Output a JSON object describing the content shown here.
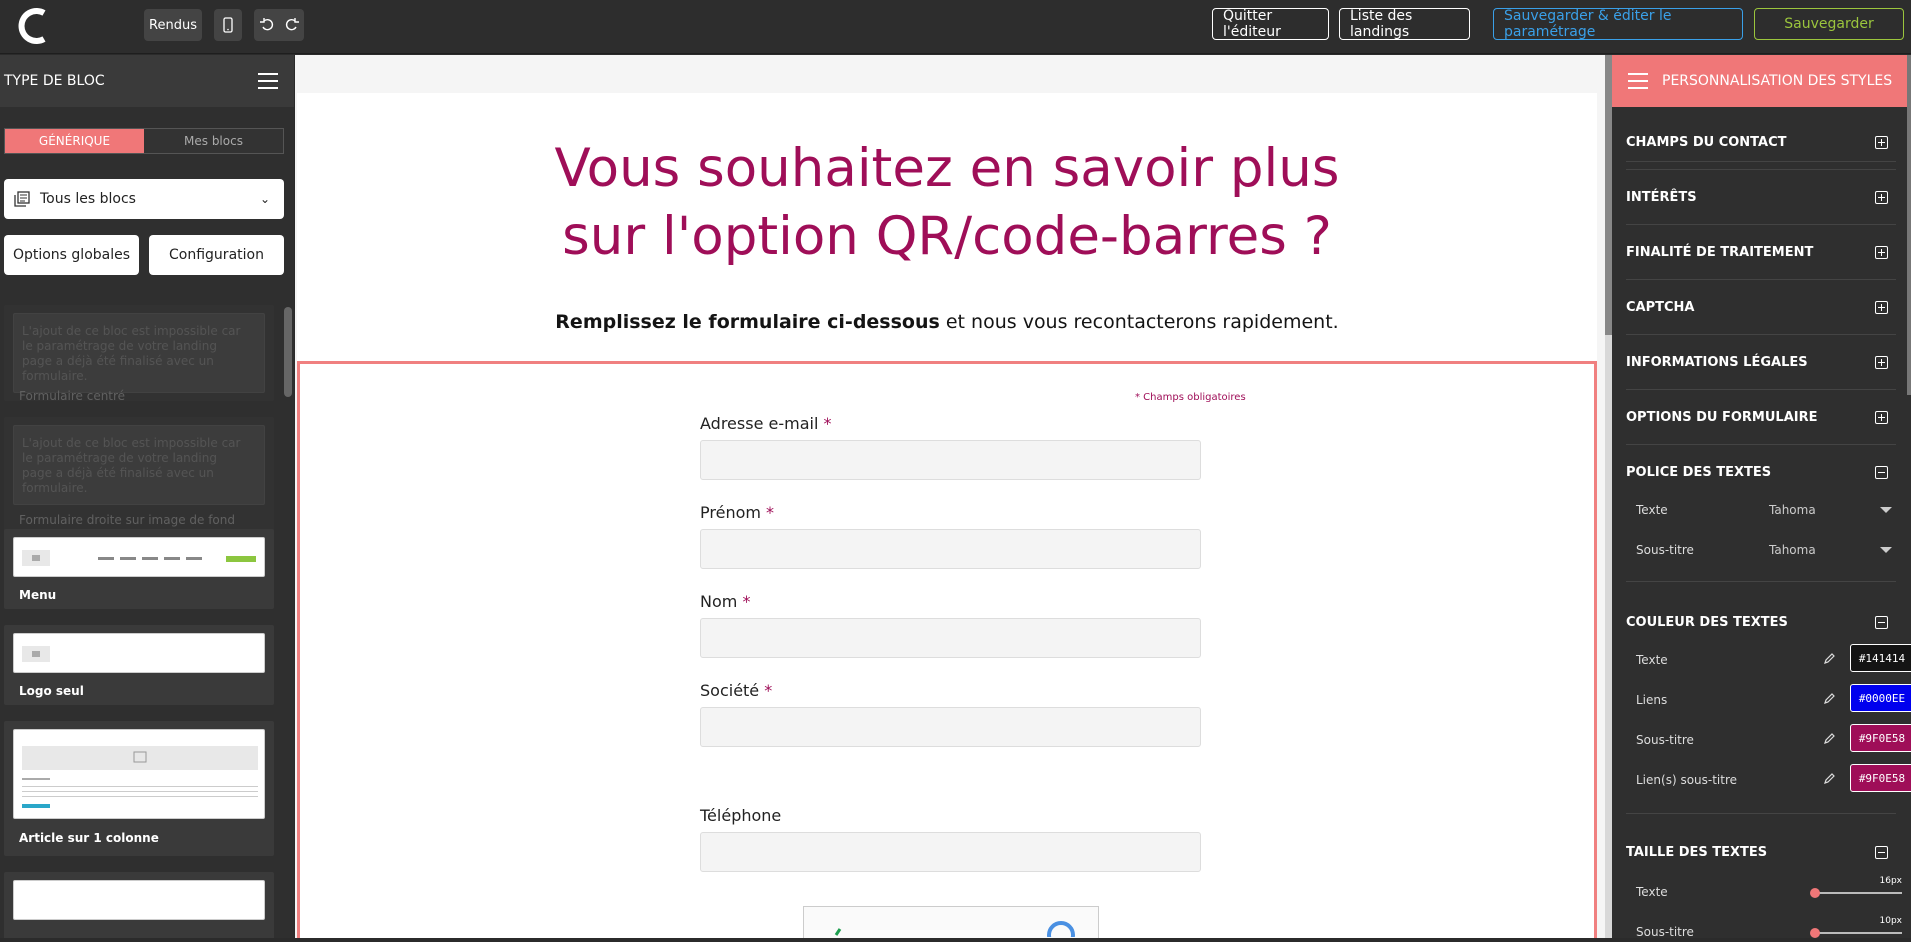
{
  "topbar": {
    "rendus": "Rendus",
    "quit": "Quitter l'éditeur",
    "list": "Liste des landings",
    "save_edit": "Sauvegarder & éditer le paramétrage",
    "save": "Sauvegarder"
  },
  "left": {
    "title": "TYPE DE BLOC",
    "seg_generic": "GÉNÉRIQUE",
    "seg_mine": "Mes blocs",
    "select_value": "Tous les blocs",
    "btn_global": "Options globales",
    "btn_config": "Configuration",
    "disabled_text": "L'ajout de ce bloc est impossible car le paramétrage de votre landing page a déjà été finalisé avec un formulaire.",
    "blocks": [
      {
        "label": "Formulaire centré"
      },
      {
        "label": "Formulaire droite sur image de fond"
      },
      {
        "label": "Menu"
      },
      {
        "label": "Logo seul"
      },
      {
        "label": "Article sur 1 colonne"
      }
    ]
  },
  "canvas": {
    "title_line1": "Vous souhaitez en savoir plus",
    "title_line2": "sur l'option QR/code-barres ?",
    "subtitle_bold": "Remplissez le formulaire ci-dessous",
    "subtitle_rest": " et nous vous recontacterons rapidement.",
    "required_note": "* Champs obligatoires",
    "fields": [
      {
        "label": "Adresse e-mail",
        "star": "*"
      },
      {
        "label": "Prénom",
        "star": "*"
      },
      {
        "label": "Nom",
        "star": "*"
      },
      {
        "label": "Société",
        "star": "*"
      },
      {
        "label": "Téléphone",
        "star": ""
      }
    ]
  },
  "right": {
    "title": "PERSONNALISATION DES STYLES",
    "sections": {
      "contact": "CHAMPS DU CONTACT",
      "interets": "INTÉRÊTS",
      "finalite": "FINALITÉ DE TRAITEMENT",
      "captcha": "CAPTCHA",
      "legal": "INFORMATIONS LÉGALES",
      "options": "OPTIONS DU FORMULAIRE",
      "police": "POLICE DES TEXTES",
      "couleur": "COULEUR DES TEXTES",
      "taille": "TAILLE DES TEXTES"
    },
    "police_rows": [
      {
        "label": "Texte",
        "value": "Tahoma"
      },
      {
        "label": "Sous-titre",
        "value": "Tahoma"
      }
    ],
    "color_rows": [
      {
        "label": "Texte",
        "value": "#141414",
        "color": "#141414"
      },
      {
        "label": "Liens",
        "value": "#0000EE",
        "color": "#0000EE"
      },
      {
        "label": "Sous-titre",
        "value": "#9F0E58",
        "color": "#9F0E58"
      },
      {
        "label": "Lien(s) sous-titre",
        "value": "#9F0E58",
        "color": "#9F0E58"
      }
    ],
    "size_rows": [
      {
        "label": "Texte",
        "value": "16px",
        "level": 0
      },
      {
        "label": "Sous-titre",
        "value": "10px",
        "level": 0
      }
    ]
  },
  "colors": {
    "accent": "#f07778",
    "brand_title": "#9f0e58",
    "blue": "#3aa0e8",
    "green": "#9bc53d"
  }
}
